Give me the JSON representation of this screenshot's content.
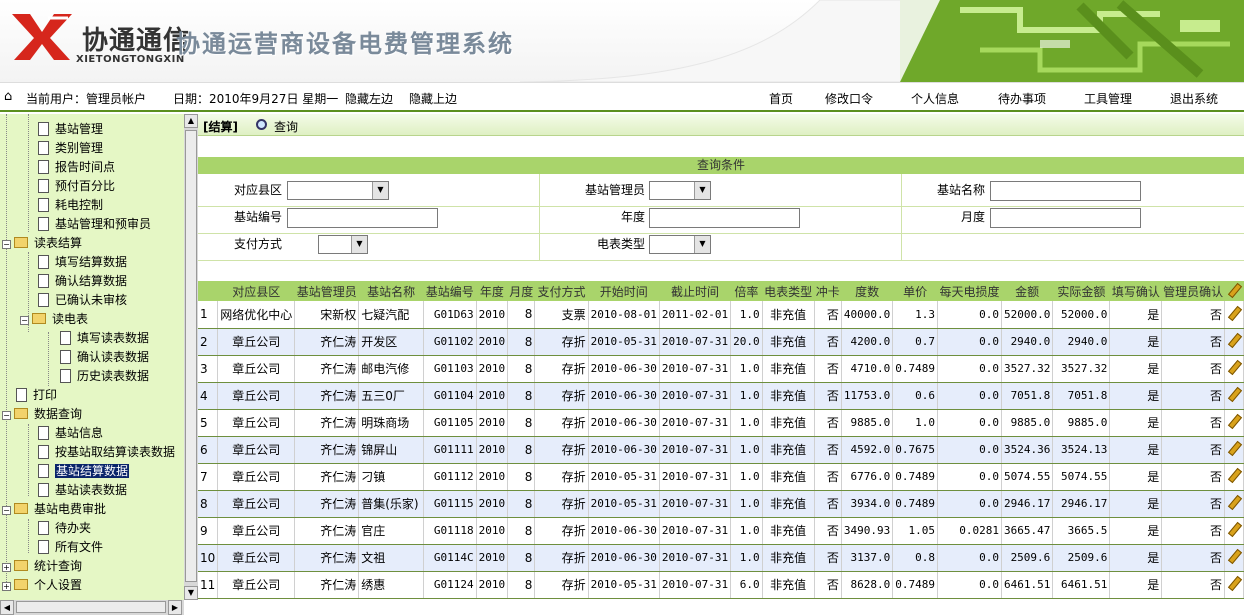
{
  "header": {
    "logo_cn": "协通通信",
    "logo_en": "XIETONGTONGXIN",
    "system_title": "协通运营商设备电费管理系统"
  },
  "infobar": {
    "current_user_label": "当前用户：管理员帐户",
    "date_label": "日期：2010年9月27日 星期一",
    "hide_left": "隐藏左边",
    "hide_top": "隐藏上边",
    "nav": [
      "首页",
      "修改口令",
      "个人信息",
      "待办事项",
      "工具管理",
      "退出系统"
    ]
  },
  "sidebar": {
    "items": [
      {
        "label": "基站管理",
        "type": "doc"
      },
      {
        "label": "类别管理",
        "type": "doc"
      },
      {
        "label": "报告时间点",
        "type": "doc"
      },
      {
        "label": "预付百分比",
        "type": "doc"
      },
      {
        "label": "耗电控制",
        "type": "doc"
      },
      {
        "label": "基站管理和预审员",
        "type": "doc"
      },
      {
        "label": "读表结算",
        "type": "folder"
      },
      {
        "label": "填写结算数据",
        "type": "doc"
      },
      {
        "label": "确认结算数据",
        "type": "doc"
      },
      {
        "label": "已确认未审核",
        "type": "doc"
      },
      {
        "label": "读电表",
        "type": "folder"
      },
      {
        "label": "填写读表数据",
        "type": "doc"
      },
      {
        "label": "确认读表数据",
        "type": "doc"
      },
      {
        "label": "历史读表数据",
        "type": "doc"
      },
      {
        "label": "打印",
        "type": "doc"
      },
      {
        "label": "数据查询",
        "type": "folder"
      },
      {
        "label": "基站信息",
        "type": "doc"
      },
      {
        "label": "按基站取结算读表数据",
        "type": "doc"
      },
      {
        "label": "基站结算数据",
        "type": "doc"
      },
      {
        "label": "基站读表数据",
        "type": "doc"
      },
      {
        "label": "基站电费审批",
        "type": "folder"
      },
      {
        "label": "待办夹",
        "type": "doc"
      },
      {
        "label": "所有文件",
        "type": "doc"
      },
      {
        "label": "统计查询",
        "type": "folder"
      },
      {
        "label": "个人设置",
        "type": "folder"
      }
    ]
  },
  "toolbar": {
    "settle_label": "[结算]",
    "query_label": "查询"
  },
  "query": {
    "title": "查询条件",
    "county_label": "对应县区",
    "manager_label": "基站管理员",
    "station_name_label": "基站名称",
    "station_no_label": "基站编号",
    "year_label": "年度",
    "month_label": "月度",
    "payment_label": "支付方式",
    "meter_type_label": "电表类型"
  },
  "table": {
    "headers": [
      "对应县区",
      "基站管理员",
      "基站名称",
      "基站编号",
      "年度",
      "月度",
      "支付方式",
      "开始时间",
      "截止时间",
      "倍率",
      "电表类型",
      "冲卡",
      "度数",
      "单价",
      "每天电损度",
      "金额",
      "实际金额",
      "填写确认",
      "管理员确认"
    ],
    "rows": [
      [
        "1",
        "网络优化中心",
        "宋新权",
        "七疑汽配",
        "G01D63",
        "2010",
        "8",
        "支票",
        "2010-08-01",
        "2011-02-01",
        "1.0",
        "非充值",
        "否",
        "40000.0",
        "1.3",
        "0.0",
        "52000.0",
        "52000.0",
        "是",
        "否"
      ],
      [
        "2",
        "章丘公司",
        "齐仁涛",
        "开发区",
        "G01102",
        "2010",
        "8",
        "存折",
        "2010-05-31",
        "2010-07-31",
        "20.0",
        "非充值",
        "否",
        "4200.0",
        "0.7",
        "0.0",
        "2940.0",
        "2940.0",
        "是",
        "否"
      ],
      [
        "3",
        "章丘公司",
        "齐仁涛",
        "邮电汽修",
        "G01103",
        "2010",
        "8",
        "存折",
        "2010-06-30",
        "2010-07-31",
        "1.0",
        "非充值",
        "否",
        "4710.0",
        "0.7489",
        "0.0",
        "3527.32",
        "3527.32",
        "是",
        "否"
      ],
      [
        "4",
        "章丘公司",
        "齐仁涛",
        "五三0厂",
        "G01104",
        "2010",
        "8",
        "存折",
        "2010-06-30",
        "2010-07-31",
        "1.0",
        "非充值",
        "否",
        "11753.0",
        "0.6",
        "0.0",
        "7051.8",
        "7051.8",
        "是",
        "否"
      ],
      [
        "5",
        "章丘公司",
        "齐仁涛",
        "明珠商场",
        "G01105",
        "2010",
        "8",
        "存折",
        "2010-06-30",
        "2010-07-31",
        "1.0",
        "非充值",
        "否",
        "9885.0",
        "1.0",
        "0.0",
        "9885.0",
        "9885.0",
        "是",
        "否"
      ],
      [
        "6",
        "章丘公司",
        "齐仁涛",
        "锦屏山",
        "G01111",
        "2010",
        "8",
        "存折",
        "2010-06-30",
        "2010-07-31",
        "1.0",
        "非充值",
        "否",
        "4592.0",
        "0.7675",
        "0.0",
        "3524.36",
        "3524.13",
        "是",
        "否"
      ],
      [
        "7",
        "章丘公司",
        "齐仁涛",
        "刁镇",
        "G01112",
        "2010",
        "8",
        "存折",
        "2010-05-31",
        "2010-07-31",
        "1.0",
        "非充值",
        "否",
        "6776.0",
        "0.7489",
        "0.0",
        "5074.55",
        "5074.55",
        "是",
        "否"
      ],
      [
        "8",
        "章丘公司",
        "齐仁涛",
        "普集(乐家)",
        "G01115",
        "2010",
        "8",
        "存折",
        "2010-05-31",
        "2010-07-31",
        "1.0",
        "非充值",
        "否",
        "3934.0",
        "0.7489",
        "0.0",
        "2946.17",
        "2946.17",
        "是",
        "否"
      ],
      [
        "9",
        "章丘公司",
        "齐仁涛",
        "官庄",
        "G01118",
        "2010",
        "8",
        "存折",
        "2010-06-30",
        "2010-07-31",
        "1.0",
        "非充值",
        "否",
        "3490.93",
        "1.05",
        "0.0281",
        "3665.47",
        "3665.5",
        "是",
        "否"
      ],
      [
        "10",
        "章丘公司",
        "齐仁涛",
        "文祖",
        "G0114C",
        "2010",
        "8",
        "存折",
        "2010-06-30",
        "2010-07-31",
        "1.0",
        "非充值",
        "否",
        "3137.0",
        "0.8",
        "0.0",
        "2509.6",
        "2509.6",
        "是",
        "否"
      ],
      [
        "11",
        "章丘公司",
        "齐仁涛",
        "绣惠",
        "G01124",
        "2010",
        "8",
        "存折",
        "2010-05-31",
        "2010-07-31",
        "6.0",
        "非充值",
        "否",
        "8628.0",
        "0.7489",
        "0.0",
        "6461.51",
        "6461.51",
        "是",
        "否"
      ]
    ]
  },
  "colors": {
    "header_green": "#6fa82a",
    "sidebar_bg": "#e5f7c5",
    "table_header_bg": "#a9d46b",
    "alt_row_bg": "#e6edfb"
  }
}
